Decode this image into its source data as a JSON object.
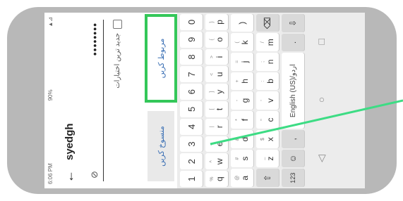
{
  "status": {
    "time": "6:06 PM",
    "battery": "90%",
    "signal": "▲⊿"
  },
  "appbar": {
    "back_icon": "back-arrow-icon",
    "back_glyph": "←",
    "title": "syedgh"
  },
  "password": {
    "masked_value": "••••••••",
    "eye_icon": "eye-off-icon",
    "eye_glyph": "⊘"
  },
  "checkbox": {
    "label": "جدید ترین اختیارات"
  },
  "buttons": {
    "cancel_label": "منسوخ کریں",
    "ok_label": "مربوط کریں"
  },
  "keyboard": {
    "numbers": [
      "1",
      "2",
      "3",
      "4",
      "5",
      "6",
      "7",
      "8",
      "9",
      "0"
    ],
    "number_subs": [
      "",
      "",
      "",
      "",
      "",
      "",
      "",
      "",
      "",
      ""
    ],
    "row1": [
      {
        "k": "q",
        "s": "%"
      },
      {
        "k": "w",
        "s": "^"
      },
      {
        "k": "e",
        "s": "~"
      },
      {
        "k": "r",
        "s": "|"
      },
      {
        "k": "t",
        "s": "["
      },
      {
        "k": "y",
        "s": "]"
      },
      {
        "k": "u",
        "s": "<"
      },
      {
        "k": "i",
        "s": ">"
      },
      {
        "k": "o",
        "s": "{"
      },
      {
        "k": "p",
        "s": "}"
      }
    ],
    "row2": [
      {
        "k": "a",
        "s": "@"
      },
      {
        "k": "s",
        "s": "#"
      },
      {
        "k": "d",
        "s": "&"
      },
      {
        "k": "f",
        "s": "*"
      },
      {
        "k": "g",
        "s": "-"
      },
      {
        "k": "h",
        "s": "+"
      },
      {
        "k": "j",
        "s": "="
      },
      {
        "k": "k",
        "s": "("
      },
      {
        "k": ")",
        "s": ""
      }
    ],
    "row3_shift": "⇧",
    "row3": [
      {
        "k": "z",
        "s": "_"
      },
      {
        "k": "x",
        "s": "$"
      },
      {
        "k": "c",
        "s": "\""
      },
      {
        "k": "v",
        "s": "'"
      },
      {
        "k": "b",
        "s": ":"
      },
      {
        "k": "n",
        "s": ";"
      },
      {
        "k": "m",
        "s": "/"
      }
    ],
    "row3_backspace": "⌫",
    "row4_symbols": "123",
    "row4_emoji": "☺",
    "row4_comma": ",",
    "row4_space": "English (US)/اردو",
    "row4_period": ".",
    "row4_enter": "⇩"
  },
  "nav": {
    "back": "◁",
    "home": "○",
    "recents": "□"
  },
  "colors": {
    "accent": "#3a6fb4",
    "highlight": "#34c759",
    "pointer": "#3ddc84"
  }
}
